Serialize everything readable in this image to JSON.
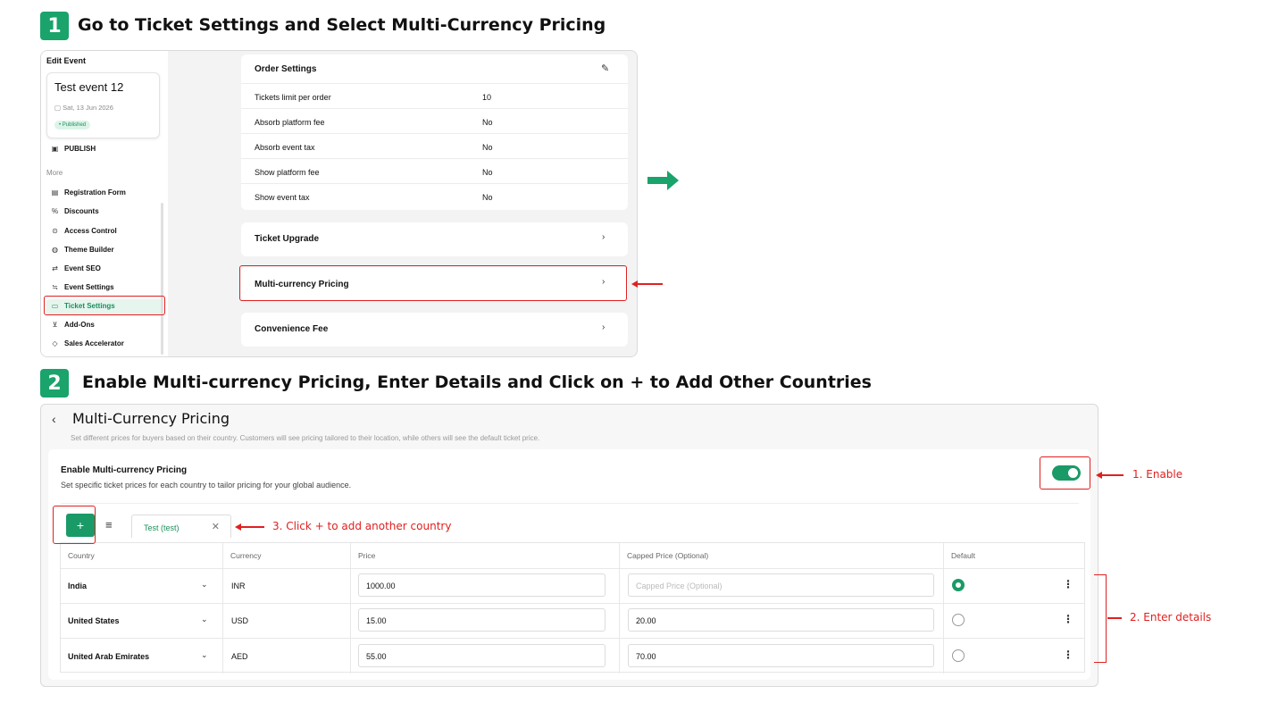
{
  "step1": {
    "number": "1",
    "title": "Go to Ticket Settings and Select Multi-Currency Pricing"
  },
  "step2": {
    "number": "2",
    "title": "Enable Multi-currency Pricing, Enter Details and Click on + to Add Other Countries"
  },
  "sidebar": {
    "heading": "Edit Event",
    "event_name": "Test event 12",
    "event_date": "Sat, 13 Jun 2026",
    "status": "• Published",
    "publish": "PUBLISH",
    "more_label": "More",
    "items": [
      {
        "label": "Registration Form",
        "icon": "▤"
      },
      {
        "label": "Discounts",
        "icon": "%"
      },
      {
        "label": "Access Control",
        "icon": "⊙"
      },
      {
        "label": "Theme Builder",
        "icon": "◍"
      },
      {
        "label": "Event SEO",
        "icon": "⇄"
      },
      {
        "label": "Event Settings",
        "icon": "≒"
      },
      {
        "label": "Ticket Settings",
        "icon": "▭"
      },
      {
        "label": "Add-Ons",
        "icon": "⊻"
      },
      {
        "label": "Sales Accelerator",
        "icon": "◇"
      }
    ]
  },
  "order_settings": {
    "title": "Order Settings",
    "rows": [
      {
        "label": "Tickets limit per order",
        "value": "10"
      },
      {
        "label": "Absorb platform fee",
        "value": "No"
      },
      {
        "label": "Absorb event tax",
        "value": "No"
      },
      {
        "label": "Show platform fee",
        "value": "No"
      },
      {
        "label": "Show event tax",
        "value": "No"
      }
    ]
  },
  "cards": {
    "ticket_upgrade": "Ticket Upgrade",
    "multi_currency": "Multi-currency Pricing",
    "convenience_fee": "Convenience Fee"
  },
  "mc_page": {
    "title": "Multi-Currency Pricing",
    "subtitle": "Set different prices for buyers based on their country. Customers will see pricing tailored to their location, while others will see the default ticket price.",
    "enable_title": "Enable Multi-currency Pricing",
    "enable_sub": "Set specific ticket prices for each country to tailor pricing for your global audience.",
    "enabled": true,
    "add_label": "+",
    "tab_label": "Test (test)",
    "columns": [
      "Country",
      "Currency",
      "Price",
      "Capped Price (Optional)",
      "Default"
    ],
    "capped_placeholder": "Capped Price (Optional)",
    "rows": [
      {
        "country": "India",
        "currency": "INR",
        "price": "1000.00",
        "capped": "",
        "default": true
      },
      {
        "country": "United States",
        "currency": "USD",
        "price": "15.00",
        "capped": "20.00",
        "default": false
      },
      {
        "country": "United Arab Emirates",
        "currency": "AED",
        "price": "55.00",
        "capped": "70.00",
        "default": false
      }
    ]
  },
  "annotations": {
    "enable": "1. Enable",
    "details": "2. Enter details",
    "add": "3. Click + to add another country"
  },
  "colors": {
    "accent": "#1a9a66",
    "annotation": "#e02020"
  }
}
